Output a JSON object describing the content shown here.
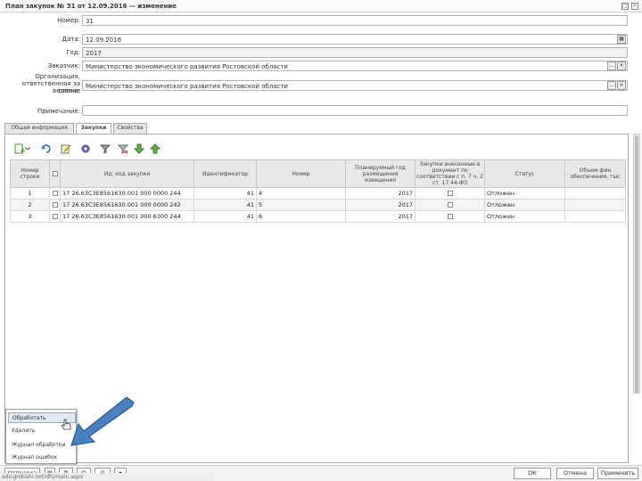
{
  "window": {
    "title": "План закупок № 31 от 12.09.2016 — изменение"
  },
  "form": {
    "number_label": "Номер:",
    "number_value": "31",
    "date_label": "Дата:",
    "date_value": "12.09.2016",
    "year_label": "Год:",
    "year_value": "2017",
    "customer_label": "Заказчик:",
    "customer_value": "Министерство экономического развития Ростовской области",
    "org_label_1": "Организация,",
    "org_label_2": "ответственная за ведение",
    "org_label_3": "плана:",
    "org_value": "Министерство экономического развития Ростовской области",
    "note_label": "Примечание:",
    "note_value": ""
  },
  "tabs": [
    {
      "label": "Общая информация"
    },
    {
      "label": "Закупки"
    },
    {
      "label": "Свойства"
    }
  ],
  "toolbar_icons": [
    "add-icon",
    "refresh-icon",
    "edit-icon",
    "settings-icon",
    "filter-icon",
    "clear-filter-icon",
    "move-down-icon",
    "move-up-icon"
  ],
  "grid": {
    "headers": [
      {
        "label": "Номер строки"
      },
      {
        "label": ""
      },
      {
        "label": "Ид. код закупки"
      },
      {
        "label": "Идентификатор"
      },
      {
        "label": "Номер"
      },
      {
        "label": "Планируемый год размещения извещения"
      },
      {
        "label": "Закупки внесенные в документ по соответствии с п. 7 ч. 2 ст. 17 44-ФЗ"
      },
      {
        "label": "Статус"
      },
      {
        "label": "Объем фин обеспечения, тыс"
      }
    ],
    "rows": [
      {
        "num": "1",
        "ikz": "17 26.63C3E8561630.001 000 0000 244",
        "ident": "41",
        "nomer": "4",
        "year": "2017",
        "status": "Отложен",
        "amount": ""
      },
      {
        "num": "2",
        "ikz": "17 26.63C3E8561630.001 000 0000 242",
        "ident": "41",
        "nomer": "5",
        "year": "2017",
        "status": "Отложен",
        "amount": ""
      },
      {
        "num": "3",
        "ikz": "17 26.63C3E8561630.001 000 6300 244",
        "ident": "41",
        "nomer": "6",
        "year": "2017",
        "status": "Отложен",
        "amount": ""
      }
    ]
  },
  "context_menu": {
    "items": [
      {
        "label": "Обработать"
      },
      {
        "label": "Удалить"
      },
      {
        "label": "Журнал обработки"
      },
      {
        "label": "Журнал ошибок"
      }
    ]
  },
  "bottom": {
    "actions_label": "Отправка",
    "ok_label": "ОК",
    "cancel_label": "Отмена",
    "apply_label": "Применить",
    "status_text": "adicgnikishi.net/dfs/main.aspx"
  },
  "colors": {
    "arrow": "#4a7fc0",
    "arrow_border": "#2c5a94"
  }
}
